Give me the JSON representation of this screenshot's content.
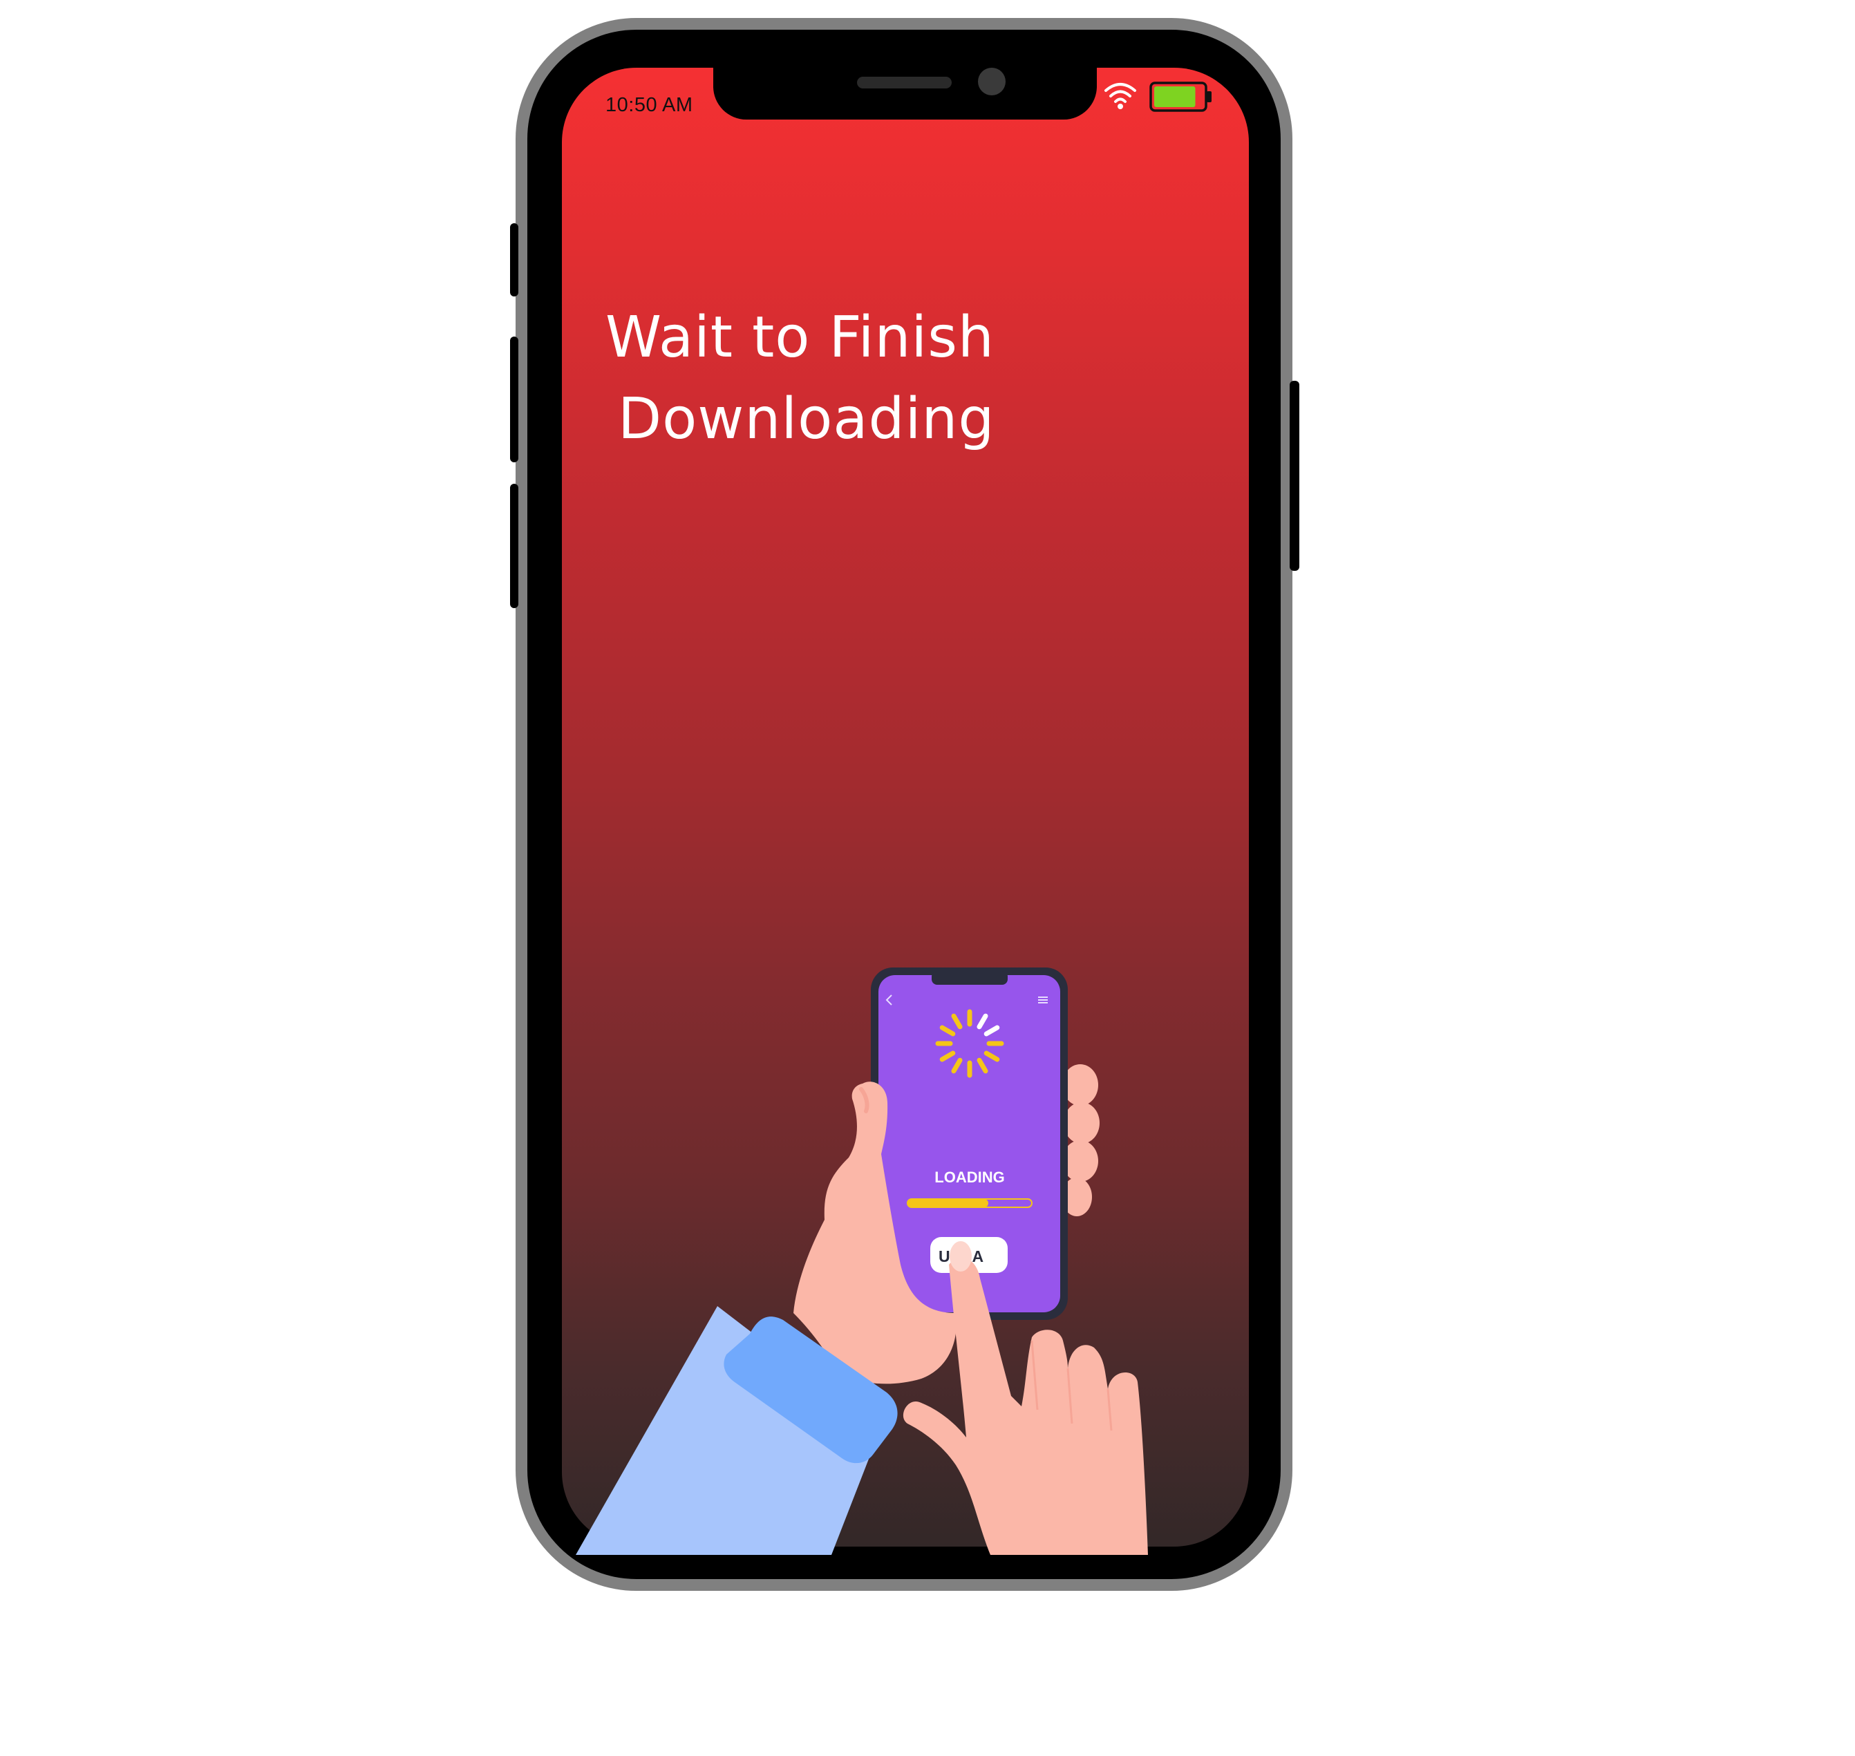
{
  "status_bar": {
    "time": "10:50 AM",
    "wifi_icon": "wifi-icon",
    "battery_icon": "battery-icon",
    "battery_level": 0.85
  },
  "screen": {
    "title_line1": "Wait to Finish",
    "title_line2": "Downloading",
    "gradient_top": "#f53033",
    "gradient_bottom": "#332828"
  },
  "illustration": {
    "inner_phone": {
      "back_icon": "chevron-left-icon",
      "menu_icon": "hamburger-menu-icon",
      "spinner_icon": "loading-spinner-icon",
      "loading_label": "LOADING",
      "progress": 0.65,
      "button_label": "UPDA"
    },
    "colors": {
      "inner_screen": "#9755ec",
      "spinner": "#f5c518",
      "skin": "#fbb7a8",
      "sleeve_dark": "#71a9fc",
      "sleeve_light": "#a7c5fc"
    }
  }
}
